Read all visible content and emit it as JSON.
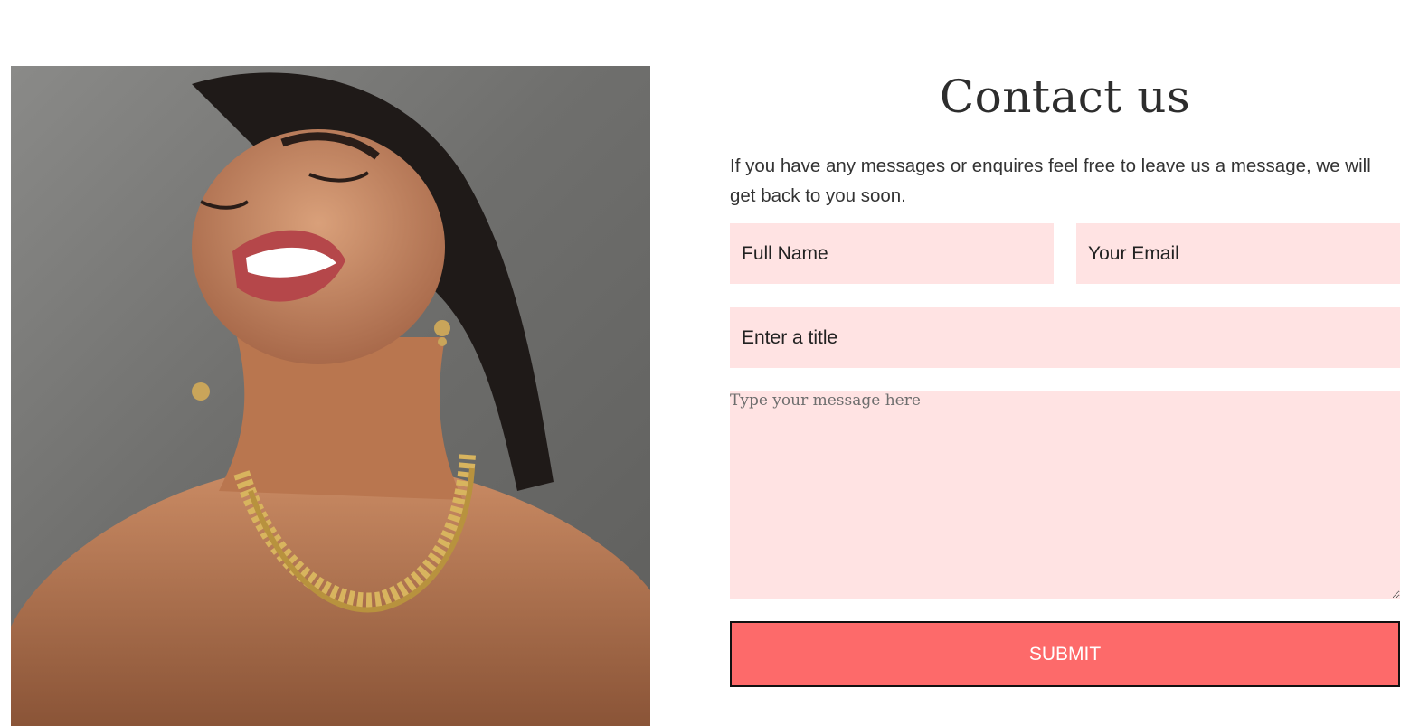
{
  "photo": {
    "alt": "Smiling woman wearing a gold necklace and earrings"
  },
  "contact": {
    "title": "Contact us",
    "intro": "If you have any messages or enquires feel free to leave us a message, we will get back to you soon.",
    "fields": {
      "full_name_placeholder": "Full Name",
      "email_placeholder": "Your Email",
      "title_placeholder": "Enter a title",
      "message_placeholder": "Type your message here"
    },
    "submit_label": "SUBMIT"
  },
  "colors": {
    "field_background": "#ffe3e3",
    "submit_background": "#fd6a6a",
    "heading_text": "#2d2d2d"
  }
}
